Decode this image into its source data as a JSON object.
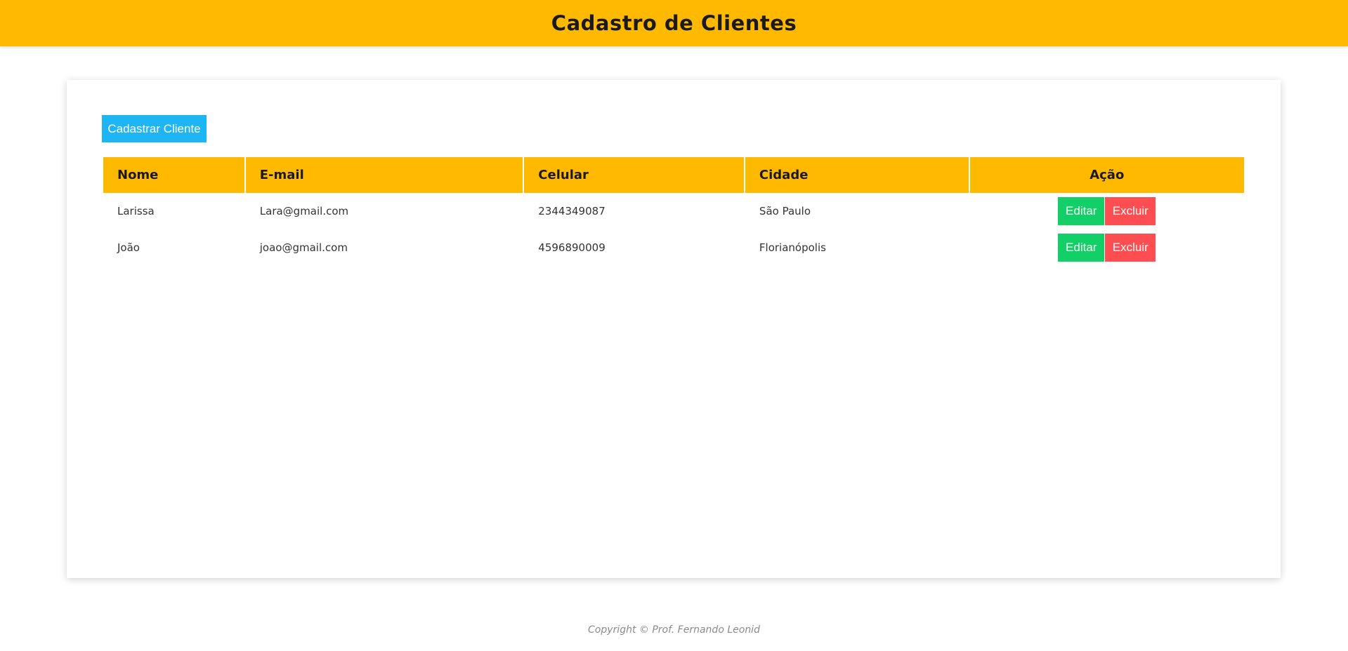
{
  "header": {
    "title": "Cadastro de Clientes"
  },
  "actions": {
    "new_client_label": "Cadastrar Cliente"
  },
  "table": {
    "columns": [
      "Nome",
      "E-mail",
      "Celular",
      "Cidade",
      "Ação"
    ],
    "rows": [
      {
        "nome": "Larissa",
        "email": "Lara@gmail.com",
        "celular": "2344349087",
        "cidade": "São Paulo",
        "edit_label": "Editar",
        "delete_label": "Excluir"
      },
      {
        "nome": "João",
        "email": "joao@gmail.com",
        "celular": "4596890009",
        "cidade": "Florianópolis",
        "edit_label": "Editar",
        "delete_label": "Excluir"
      }
    ]
  },
  "footer": {
    "text": "Copyright © Prof. Fernando Leonid"
  },
  "colors": {
    "header_bg": "#ffba00",
    "primary_button": "#1eb5f5",
    "edit_button": "#13cf68",
    "delete_button": "#fe4e52"
  }
}
